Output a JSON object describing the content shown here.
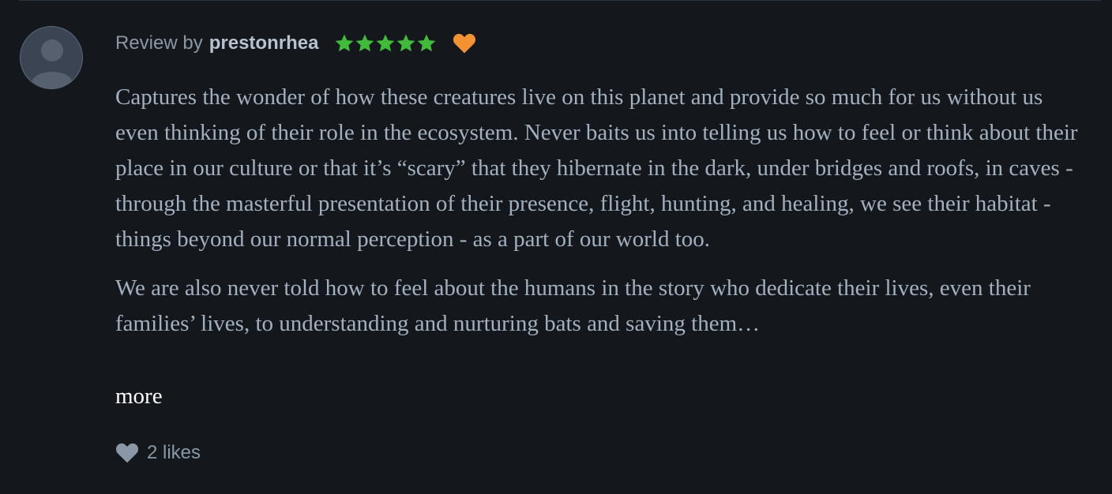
{
  "review": {
    "attribution_prefix": "Review by",
    "author": "prestonrhea",
    "rating_stars": 5,
    "liked": true,
    "paragraphs": [
      "Captures the wonder of how these creatures live on this planet and provide so much for us without us even thinking of their role in the ecosystem. Never baits us into telling us how to feel or think about their place in our culture or that it’s “scary” that they hibernate in the dark, under bridges and roofs, in caves - through the masterful presentation of their presence, flight, hunting, and healing, we see their habitat - things beyond our normal perception - as a part of our world too.",
      "We are also never told how to feel about the humans in the story who dedicate their lives, even their families’ lives, to understanding and nurturing bats and saving them…"
    ],
    "more_label": "more",
    "likes_label": "2 likes"
  },
  "colors": {
    "background": "#14181c",
    "star": "#40bc3a",
    "liked_heart": "#f39233",
    "likes_heart": "#8a97a6",
    "body_text": "#a2b0bf"
  },
  "icons": {
    "avatar": "default-avatar-icon",
    "star": "star-icon",
    "liked": "heart-icon",
    "likes": "heart-icon"
  }
}
